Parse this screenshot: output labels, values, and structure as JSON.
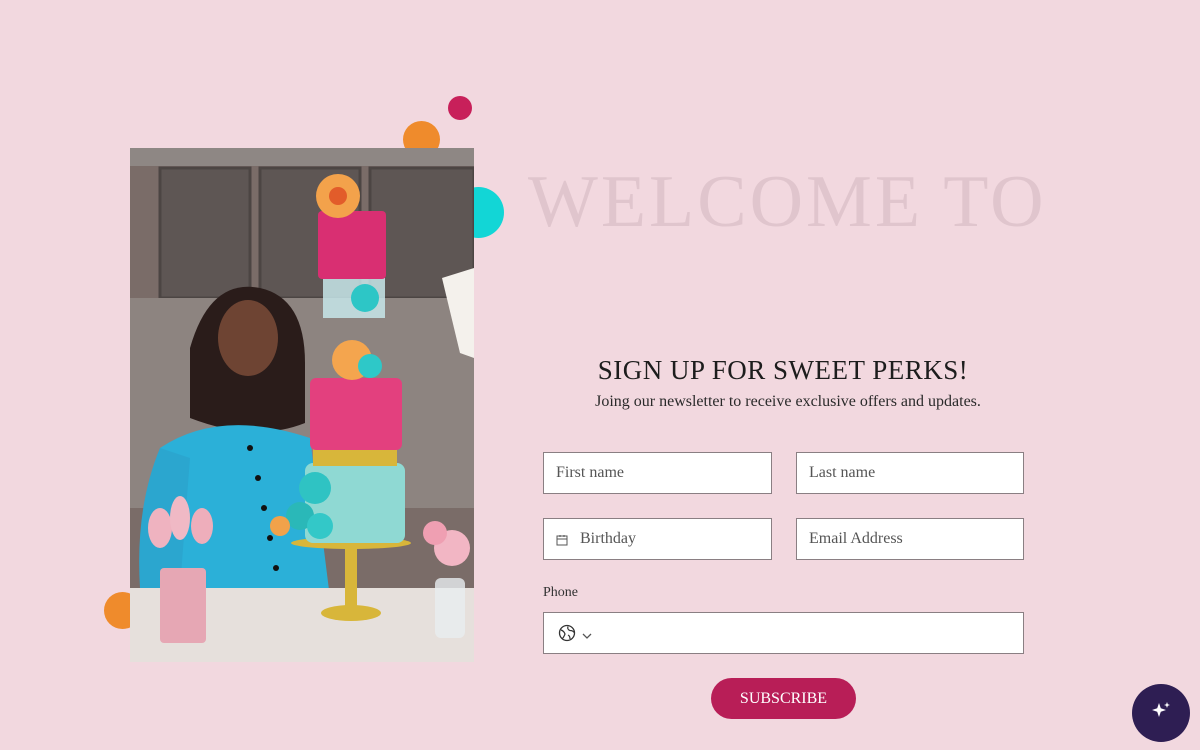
{
  "welcome": {
    "heading": "WELCOME TO"
  },
  "signup": {
    "title": "SIGN UP FOR SWEET PERKS!",
    "subtitle": "Joing our newsletter to receive exclusive offers and updates."
  },
  "form": {
    "first_name_placeholder": "First name",
    "last_name_placeholder": "Last name",
    "birthday_placeholder": "Birthday",
    "email_placeholder": "Email Address",
    "phone_label": "Phone",
    "submit_label": "SUBSCRIBE"
  },
  "icons": {
    "calendar": "calendar-icon",
    "globe": "globe-icon",
    "chevron": "chevron-down-icon",
    "sparkle": "sparkle-icon"
  },
  "colors": {
    "background": "#f2d8df",
    "accent": "#b81e57",
    "dot_orange": "#ef8b2c",
    "dot_cyan": "#12d6d6",
    "dot_crimson": "#c8205a",
    "ai_button": "#2e1e53"
  }
}
